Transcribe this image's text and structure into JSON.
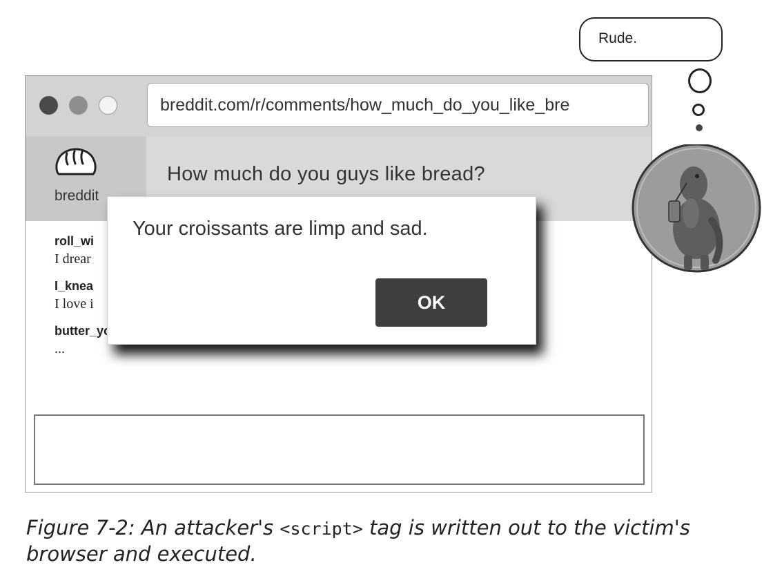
{
  "browser": {
    "url": "breddit.com/r/comments/how_much_do_you_like_bre",
    "window_controls": [
      "close-dot",
      "minimize-dot",
      "maximize-dot"
    ]
  },
  "site": {
    "logo_text": "breddit",
    "logo_icon": "bread-loaf-icon",
    "page_title": "How much do you guys like bread?"
  },
  "comments": [
    {
      "user": "roll_wi",
      "text": "I drear"
    },
    {
      "user": "I_knea",
      "text": "I love i"
    },
    {
      "user": "butter_you_than_me",
      "text": "..."
    }
  ],
  "alert": {
    "message": "Your croissants are limp and sad.",
    "ok_label": "OK"
  },
  "speech": {
    "text": "Rude."
  },
  "character_icon": "monster-drinking-icon",
  "caption": {
    "before": "Figure 7-2: An attacker's ",
    "code": "<script>",
    "after": " tag is written out to the victim's browser and executed."
  }
}
